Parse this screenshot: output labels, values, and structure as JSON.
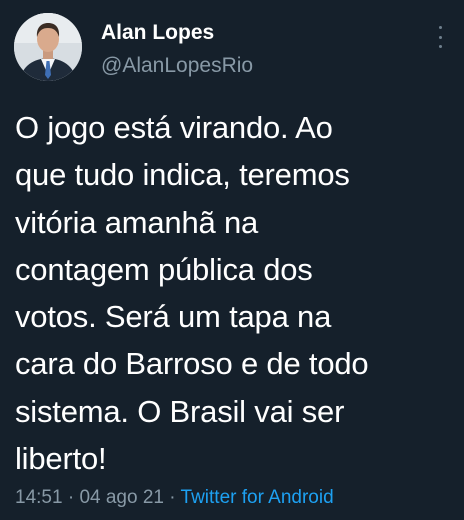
{
  "author": {
    "display_name": "Alan Lopes",
    "handle": "@AlanLopesRio",
    "avatar_icon": "profile-photo"
  },
  "tweet": {
    "lines": [
      "O jogo está virando. Ao",
      "que tudo indica, teremos",
      "vitória amanhã na",
      "contagem pública dos",
      "votos. Será um tapa na",
      "cara do Barroso e de todo",
      "sistema. O Brasil vai ser",
      "liberto!"
    ]
  },
  "meta": {
    "time": "14:51",
    "separator": "·",
    "date": "04 ago 21",
    "source": "Twitter for Android"
  },
  "colors": {
    "background": "#15202b",
    "text": "#ffffff",
    "muted": "#8899a6",
    "link": "#1da1f2"
  },
  "icons": {
    "more": "more-vertical-icon"
  }
}
